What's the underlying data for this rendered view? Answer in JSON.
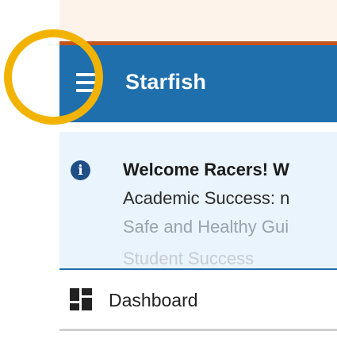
{
  "header": {
    "app_title": "Starfish",
    "menu_icon": "hamburger-menu-icon",
    "color": "#1f6fad"
  },
  "highlight": {
    "color": "#f2b300"
  },
  "notice": {
    "icon": "info-icon",
    "icon_glyph": "i",
    "lines": [
      "Welcome Racers! W",
      "Academic Success: n",
      "Safe and Healthy Gui",
      "Student Success"
    ]
  },
  "nav": {
    "dashboard": {
      "label": "Dashboard",
      "icon": "dashboard-icon"
    }
  }
}
